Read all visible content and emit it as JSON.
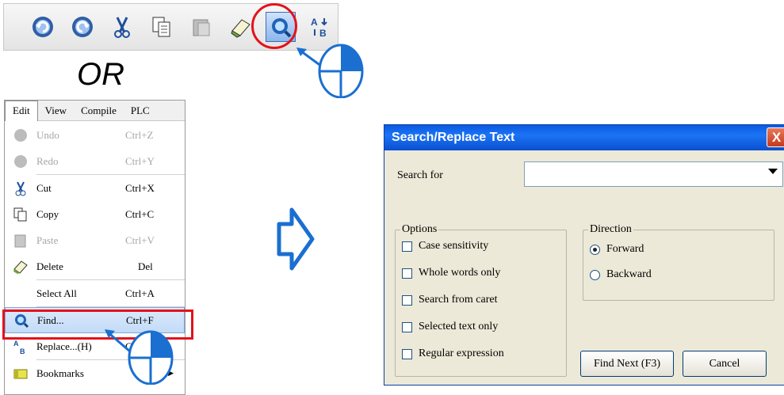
{
  "or_text": "OR",
  "toolbar": {
    "buttons": [
      {
        "name": "undo-icon"
      },
      {
        "name": "redo-icon"
      },
      {
        "name": "cut-icon"
      },
      {
        "name": "copy-icon"
      },
      {
        "name": "paste-icon"
      },
      {
        "name": "delete-icon"
      },
      {
        "name": "find-icon",
        "highlighted": true
      },
      {
        "name": "replace-icon"
      }
    ]
  },
  "menubar": {
    "items": [
      "Edit",
      "View",
      "Compile",
      "PLC"
    ]
  },
  "edit_menu": {
    "items": [
      {
        "label": "Undo",
        "shortcut": "Ctrl+Z",
        "disabled": true,
        "icon": "undo-icon"
      },
      {
        "label": "Redo",
        "shortcut": "Ctrl+Y",
        "disabled": true,
        "icon": "redo-icon"
      },
      {
        "label": "Cut",
        "shortcut": "Ctrl+X",
        "disabled": false,
        "icon": "cut-icon"
      },
      {
        "label": "Copy",
        "shortcut": "Ctrl+C",
        "disabled": false,
        "icon": "copy-icon"
      },
      {
        "label": "Paste",
        "shortcut": "Ctrl+V",
        "disabled": true,
        "icon": "paste-icon"
      },
      {
        "label": "Delete",
        "shortcut": "Del",
        "disabled": false,
        "icon": "delete-icon"
      },
      {
        "label": "Select All",
        "shortcut": "Ctrl+A",
        "disabled": false,
        "icon": ""
      },
      {
        "label": "Find...",
        "shortcut": "Ctrl+F",
        "disabled": false,
        "icon": "find-icon",
        "highlighted": true
      },
      {
        "label": "Replace...(H)",
        "shortcut": "C",
        "disabled": false,
        "icon": "replace-icon"
      },
      {
        "label": "Bookmarks",
        "shortcut": "",
        "disabled": false,
        "icon": "bookmark-icon",
        "submenu": true
      }
    ]
  },
  "dialog": {
    "title": "Search/Replace Text",
    "close": "X",
    "search_label": "Search for",
    "search_value": "",
    "options_legend": "Options",
    "options": [
      {
        "label": "Case sensitivity",
        "checked": false
      },
      {
        "label": "Whole words only",
        "checked": false
      },
      {
        "label": "Search from caret",
        "checked": false
      },
      {
        "label": "Selected text only",
        "checked": false
      },
      {
        "label": "Regular expression",
        "checked": false
      }
    ],
    "direction_legend": "Direction",
    "directions": [
      {
        "label": "Forward",
        "selected": true
      },
      {
        "label": "Backward",
        "selected": false
      }
    ],
    "find_next_label": "Find Next (F3)",
    "cancel_label": "Cancel"
  },
  "colors": {
    "highlight_red": "#e3131b",
    "click_blue": "#1a6fd1",
    "title_blue": "#0a5ae2"
  }
}
